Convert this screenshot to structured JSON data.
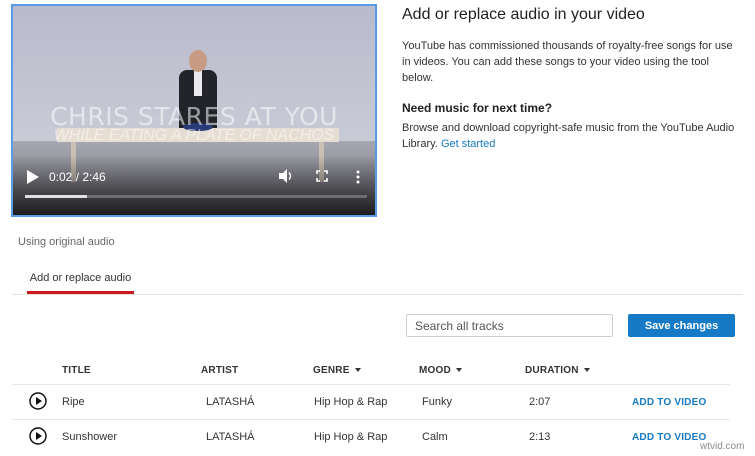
{
  "video": {
    "overlay_title": "CHRIS STARES AT YOU",
    "overlay_subtitle": "WHILE EATING A PLATE OF NACHOS",
    "time_display": "0:02 / 2:46",
    "progress_fraction": 0.18
  },
  "info": {
    "heading": "Add or replace audio in your video",
    "description": "YouTube has commissioned thousands of royalty-free songs for use in videos. You can add these songs to your video using the tool below.",
    "subheading": "Need music for next time?",
    "subdescription": "Browse and download copyright-safe music from the YouTube Audio Library.",
    "link_label": "Get started"
  },
  "status": {
    "using_audio": "Using original audio"
  },
  "tabs": {
    "active_label": "Add or replace audio"
  },
  "toolbar": {
    "search_placeholder": "Search all tracks",
    "save_label": "Save changes"
  },
  "table": {
    "headers": {
      "title": "TITLE",
      "artist": "ARTIST",
      "genre": "GENRE",
      "mood": "MOOD",
      "duration": "DURATION"
    },
    "rows": [
      {
        "title": "Ripe",
        "artist": "LATASHÁ",
        "genre": "Hip Hop & Rap",
        "mood": "Funky",
        "duration": "2:07",
        "action": "ADD TO VIDEO"
      },
      {
        "title": "Sunshower",
        "artist": "LATASHÁ",
        "genre": "Hip Hop & Rap",
        "mood": "Calm",
        "duration": "2:13",
        "action": "ADD TO VIDEO"
      }
    ]
  },
  "watermark": "wtvid.com",
  "colors": {
    "accent": "#167ac6",
    "tab_underline": "#cc181e",
    "player_border": "#5a9be8"
  }
}
